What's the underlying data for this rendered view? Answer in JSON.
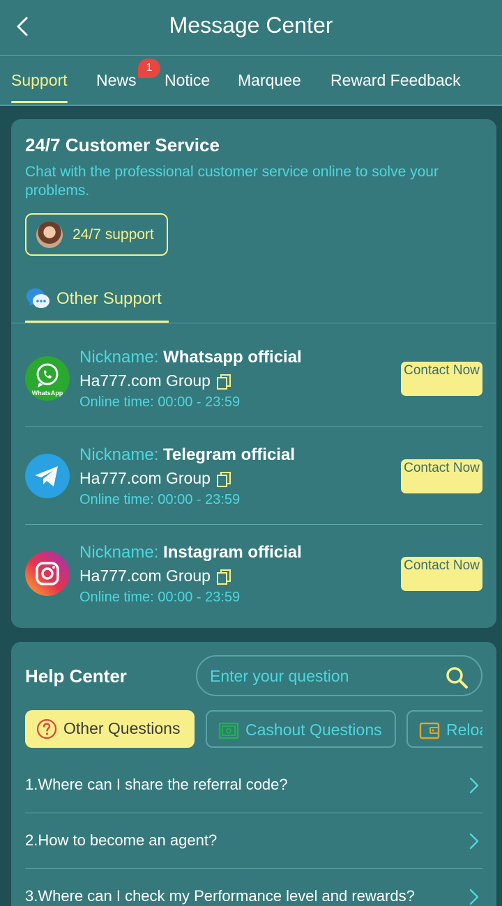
{
  "header": {
    "title": "Message Center"
  },
  "tabs": [
    {
      "label": "Support",
      "active": true
    },
    {
      "label": "News",
      "badge": "1"
    },
    {
      "label": "Notice"
    },
    {
      "label": "Marquee"
    },
    {
      "label": "Reward Feedback"
    }
  ],
  "customer_service": {
    "title": "24/7 Customer Service",
    "description": "Chat with the professional customer service online to solve your problems.",
    "support_button_label": "24/7 support",
    "other_support_label": "Other Support"
  },
  "contacts": [
    {
      "nickname_key": "Nickname:",
      "nickname": "Whatsapp official",
      "group": "Ha777.com Group",
      "online_key": "Online time:",
      "online_time": "00:00 - 23:59",
      "button": "Contact Now",
      "icon": "whatsapp-icon",
      "icon_caption": "WhatsApp"
    },
    {
      "nickname_key": "Nickname:",
      "nickname": "Telegram official",
      "group": "Ha777.com Group",
      "online_key": "Online time:",
      "online_time": "00:00 - 23:59",
      "button": "Contact Now",
      "icon": "telegram-icon"
    },
    {
      "nickname_key": "Nickname:",
      "nickname": "Instagram official",
      "group": "Ha777.com Group",
      "online_key": "Online time:",
      "online_time": "00:00 - 23:59",
      "button": "Contact Now",
      "icon": "instagram-icon"
    }
  ],
  "help_center": {
    "title": "Help Center",
    "search_placeholder": "Enter your question",
    "categories": [
      {
        "label": "Other Questions",
        "icon": "question-circle-icon",
        "active": true
      },
      {
        "label": "Cashout Questions",
        "icon": "cash-icon"
      },
      {
        "label": "Reload Questions",
        "icon": "wallet-icon"
      }
    ],
    "faqs": [
      "1.Where can I share the referral code?",
      "2.How to become an agent?",
      "3.Where can I check my Performance level and rewards?"
    ]
  },
  "colors": {
    "background": "#1e4f55",
    "panel": "#35797d",
    "accent_yellow": "#f7f08a",
    "accent_cyan": "#4fd6de",
    "badge_red": "#e8463f"
  }
}
